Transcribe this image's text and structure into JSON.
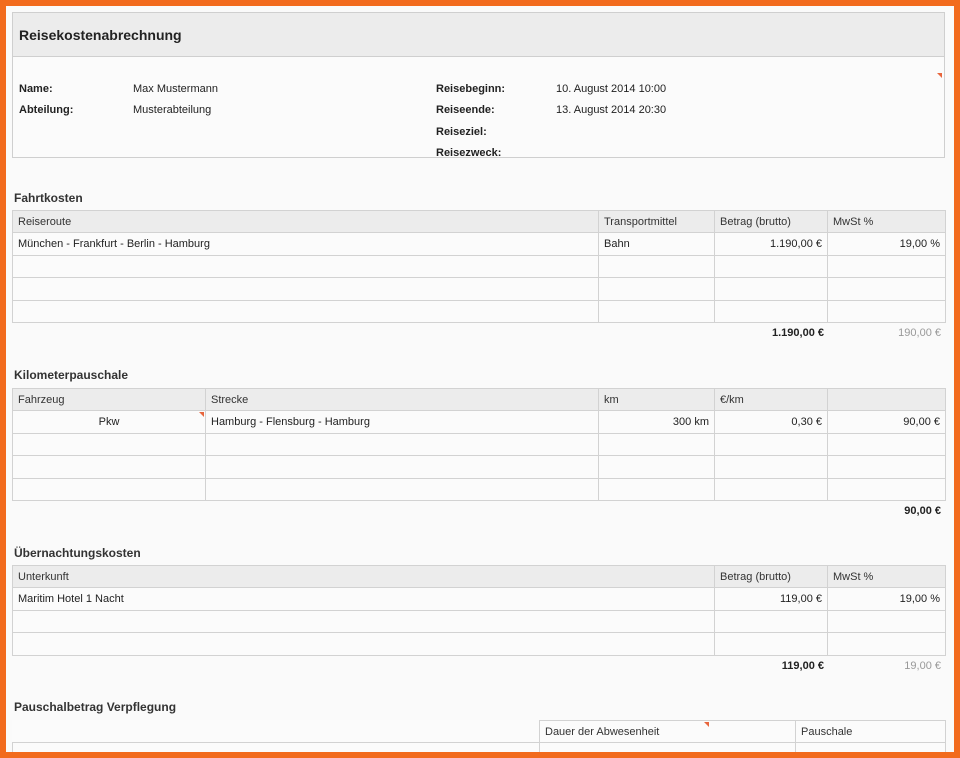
{
  "title": "Reisekostenabrechnung",
  "header": {
    "name_label": "Name:",
    "name_value": "Max Mustermann",
    "abteilung_label": "Abteilung:",
    "abteilung_value": "Musterabteilung",
    "reisebeginn_label": "Reisebeginn:",
    "reisebeginn_value": "10. August 2014 10:00",
    "reiseende_label": "Reiseende:",
    "reiseende_value": "13. August 2014 20:30",
    "reiseziel_label": "Reiseziel:",
    "reisezweck_label": "Reisezweck:"
  },
  "fahrtkosten": {
    "title": "Fahrtkosten",
    "columns": [
      "Reiseroute",
      "Transportmittel",
      "Betrag (brutto)",
      "MwSt %"
    ],
    "rows": [
      [
        "München - Frankfurt - Berlin - Hamburg",
        "Bahn",
        "1.190,00 €",
        "19,00 %"
      ]
    ],
    "total_brutto": "1.190,00 €",
    "total_mwst": "190,00 €"
  },
  "kilometerpauschale": {
    "title": "Kilometerpauschale",
    "columns": [
      "Fahrzeug",
      "Strecke",
      "km",
      "€/km",
      ""
    ],
    "rows": [
      [
        "Pkw",
        "Hamburg - Flensburg - Hamburg",
        "300 km",
        "0,30 €",
        "90,00 €"
      ]
    ],
    "total": "90,00 €"
  },
  "uebernachtung": {
    "title": "Übernachtungskosten",
    "columns": [
      "Unterkunft",
      "Betrag (brutto)",
      "MwSt %"
    ],
    "rows": [
      [
        "Maritim Hotel 1 Nacht",
        "119,00 €",
        "19,00 %"
      ]
    ],
    "total_brutto": "119,00 €",
    "total_mwst": "19,00 €"
  },
  "verpflegung": {
    "title": "Pauschalbetrag Verpflegung",
    "col_dauer": "Dauer der Abwesenheit",
    "col_pauschale": "Pauschale"
  },
  "colors": {
    "frame": "#f26b1d",
    "header_bg": "#ececec",
    "corner_mark": "#e8663d"
  }
}
